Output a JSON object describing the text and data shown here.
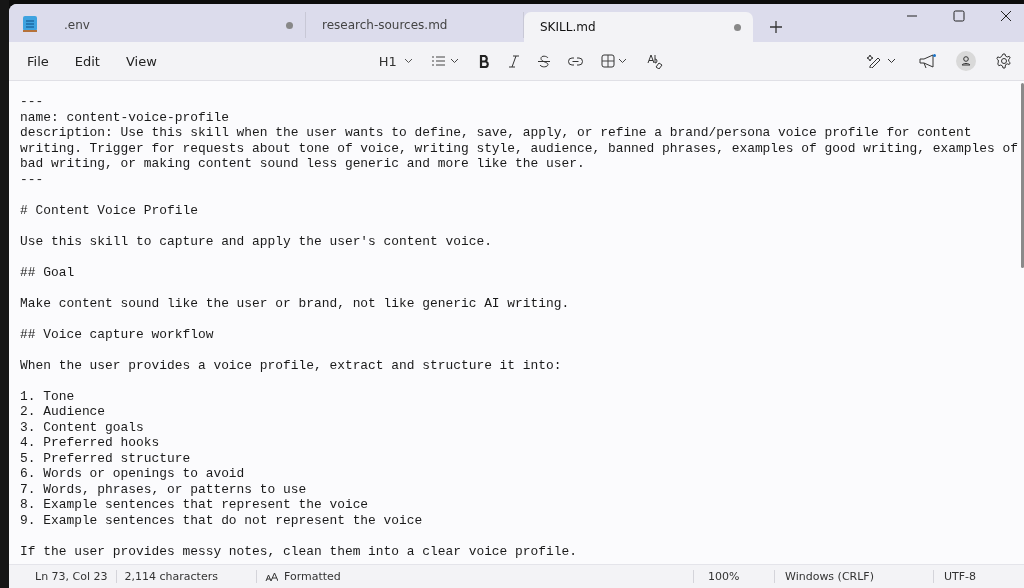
{
  "tabs": [
    {
      "label": ".env",
      "selected": false,
      "unsaved": true
    },
    {
      "label": "research-sources.md",
      "selected": false,
      "unsaved": false
    },
    {
      "label": "SKILL.md",
      "selected": true,
      "unsaved": true
    }
  ],
  "menu": [
    "File",
    "Edit",
    "View"
  ],
  "toolbar": {
    "heading": "H1"
  },
  "document": {
    "blocks": [
      [
        "---",
        "name: content-voice-profile",
        "description: Use this skill when the user wants to define, save, apply, or refine a brand/persona voice profile for content",
        "writing. Trigger for requests about tone of voice, writing style, audience, banned phrases, examples of good writing, examples of",
        "bad writing, or making content sound less generic and more like the user.",
        "---"
      ],
      [
        "# Content Voice Profile"
      ],
      [
        "Use this skill to capture and apply the user's content voice."
      ],
      [
        "## Goal"
      ],
      [
        "Make content sound like the user or brand, not like generic AI writing."
      ],
      [
        "## Voice capture workflow"
      ],
      [
        "When the user provides a voice profile, extract and structure it into:"
      ],
      [
        "1. Tone",
        "2. Audience",
        "3. Content goals",
        "4. Preferred hooks",
        "5. Preferred structure",
        "6. Words or openings to avoid",
        "7. Words, phrases, or patterns to use",
        "8. Example sentences that represent the voice",
        "9. Example sentences that do not represent the voice"
      ],
      [
        "If the user provides messy notes, clean them into a clear voice profile."
      ]
    ]
  },
  "status_bar": {
    "position": "Ln 73, Col 23",
    "characters": "2,114 characters",
    "format": "Formatted",
    "zoom": "100%",
    "line_ending": "Windows (CRLF)",
    "encoding": "UTF-8"
  }
}
